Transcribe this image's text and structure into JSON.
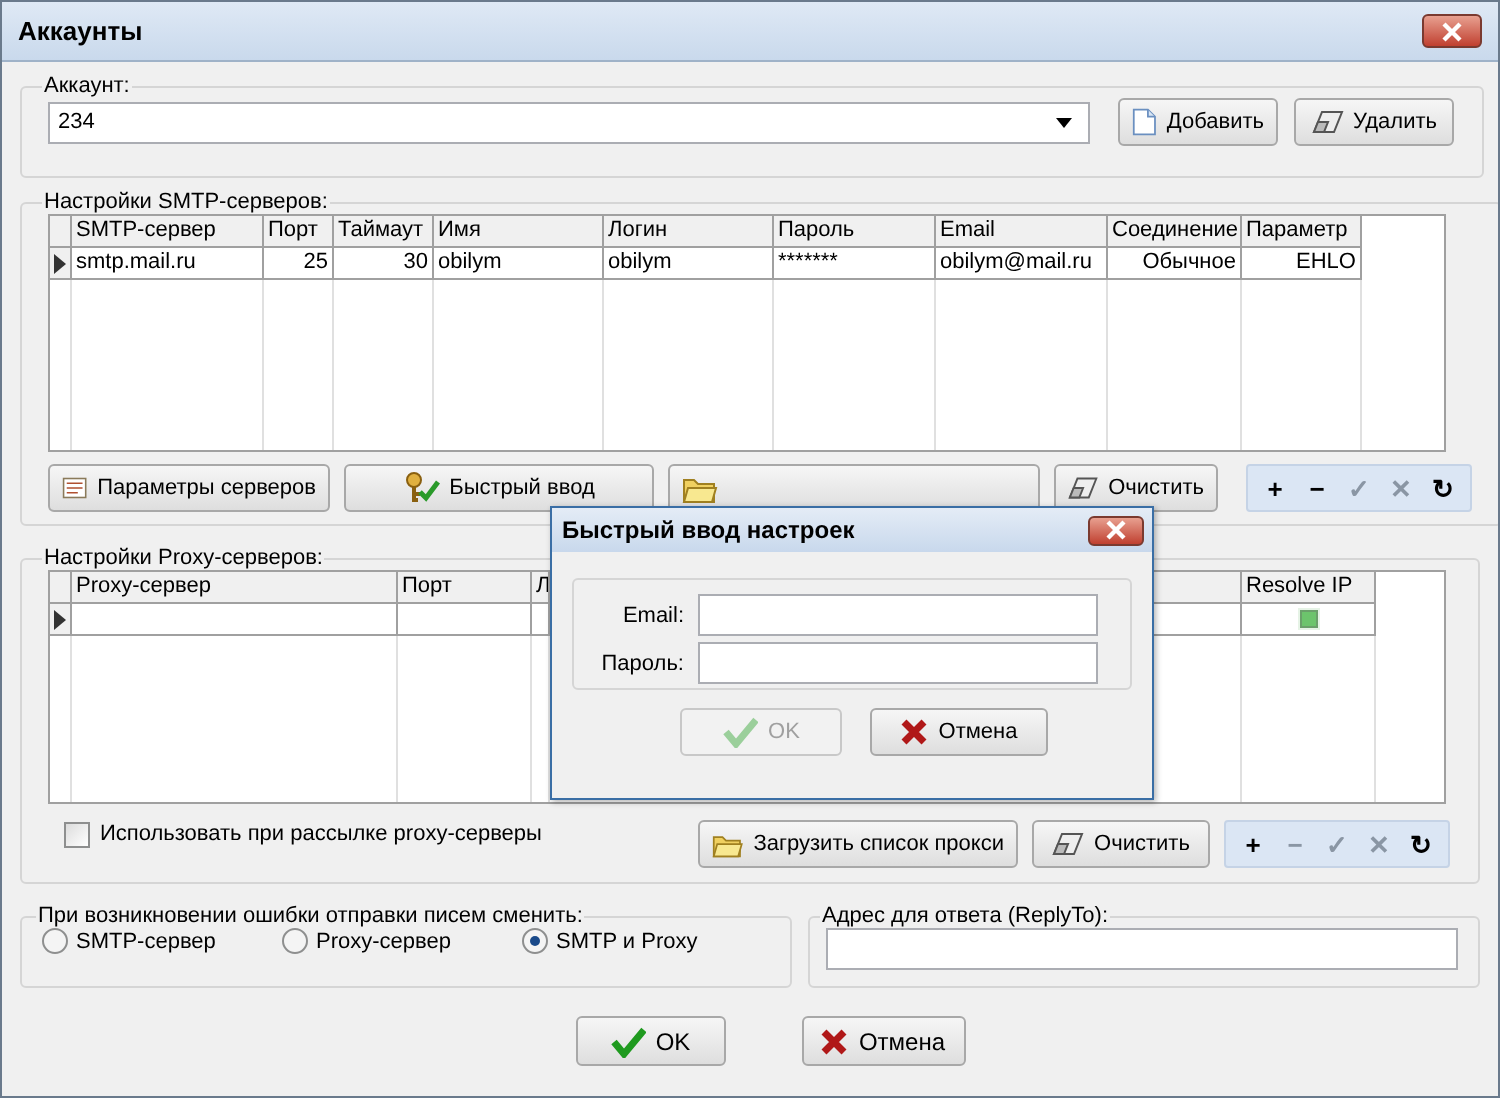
{
  "window": {
    "title": "Аккаунты"
  },
  "account": {
    "label": "Аккаунт:",
    "value": "234",
    "buttons": [
      {
        "label": "Добавить",
        "kind": "add"
      },
      {
        "label": "Удалить",
        "kind": "delete"
      }
    ]
  },
  "smtp": {
    "title": "Настройки SMTP-серверов:",
    "columns": [
      "SMTP-сервер",
      "Порт",
      "Таймаут",
      "Имя",
      "Логин",
      "Пароль",
      "Email",
      "Соединение",
      "Параметр"
    ],
    "rows": [
      {
        "cells": [
          "smtp.mail.ru",
          "25",
          "30",
          "obilym",
          "obilym",
          "*******",
          "obilym@mail.ru",
          "Обычное",
          "EHLO"
        ],
        "selected": true
      }
    ],
    "buttons": [
      {
        "label": "Параметры серверов",
        "kind": "params"
      },
      {
        "label": "Быстрый ввод",
        "kind": "keys"
      },
      {
        "kind": "folder"
      },
      {
        "label": "Очистить",
        "kind": "eraser"
      }
    ],
    "nav": [
      {
        "label": "+",
        "disabled": false
      },
      {
        "label": "−",
        "disabled": false
      },
      {
        "label": "✓",
        "disabled": true
      },
      {
        "label": "✕",
        "disabled": true
      },
      {
        "label": "↻",
        "disabled": false
      }
    ]
  },
  "proxy": {
    "title": "Настройки Proxy-серверов:",
    "columns": [
      "Proxy-сервер",
      "Порт",
      "Л",
      "Resolve IP"
    ],
    "rows": [
      {
        "selected": true,
        "resolve_ip": true
      }
    ],
    "use_proxy": {
      "label": "Использовать при рассылке proxy-серверы",
      "checked": false
    },
    "buttons": [
      {
        "label": "Загрузить список прокси",
        "kind": "folder"
      },
      {
        "label": "Очистить",
        "kind": "eraser"
      }
    ],
    "nav": [
      {
        "label": "+",
        "disabled": false
      },
      {
        "label": "−",
        "disabled": true
      },
      {
        "label": "✓",
        "disabled": true
      },
      {
        "label": "✕",
        "disabled": true
      },
      {
        "label": "↻",
        "disabled": false
      }
    ]
  },
  "on_error": {
    "title": "При возникновении ошибки отправки писем сменить:",
    "options": [
      {
        "label": "SMTP-сервер",
        "selected": false
      },
      {
        "label": "Proxy-сервер",
        "selected": false
      },
      {
        "label": "SMTP и Proxy",
        "selected": true
      }
    ]
  },
  "reply_to": {
    "label": "Адрес для ответа (ReplyTo):"
  },
  "buttons": [
    {
      "label": "OK",
      "kind": "ok",
      "disabled": false
    },
    {
      "label": "Отмена",
      "kind": "cancel",
      "disabled": false
    }
  ],
  "dialog": {
    "title": "Быстрый ввод настроек",
    "fields": [
      {
        "label": "Email:"
      },
      {
        "label": "Пароль:"
      }
    ],
    "buttons": [
      {
        "label": "OK",
        "kind": "ok",
        "disabled": true
      },
      {
        "label": "Отмена",
        "kind": "cancel",
        "disabled": false
      }
    ]
  }
}
